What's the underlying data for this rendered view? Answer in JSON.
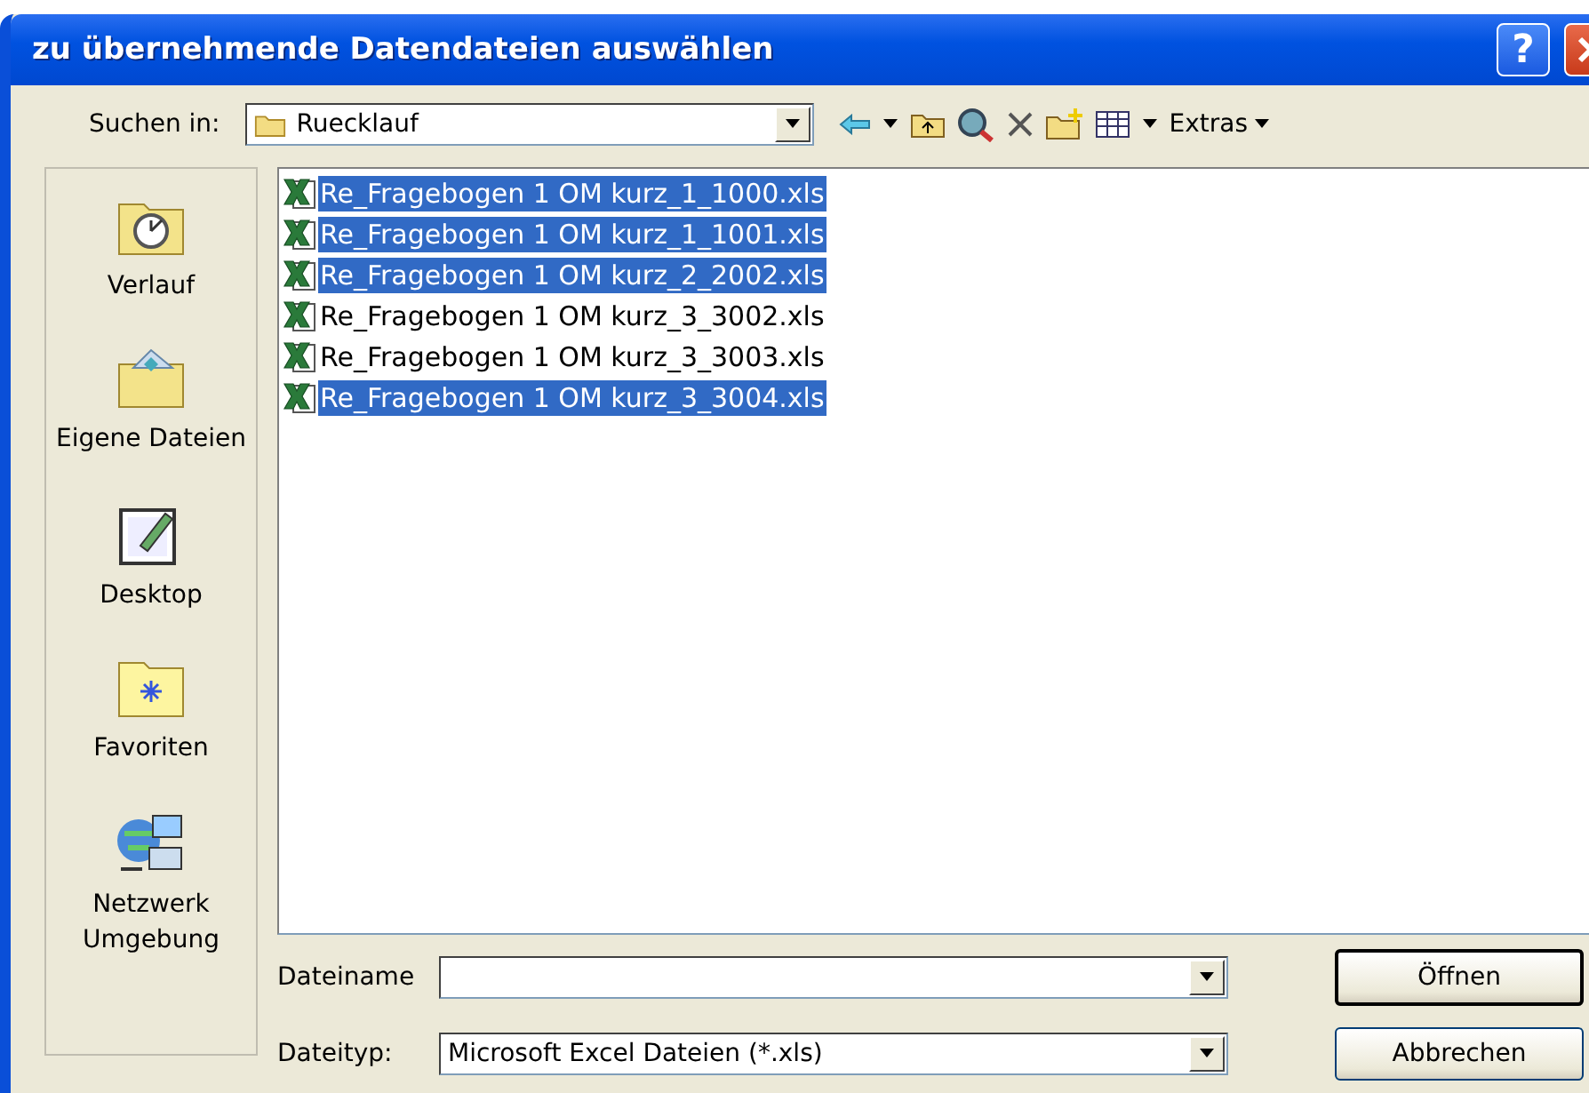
{
  "window": {
    "title": "zu übernehmende Datendateien auswählen",
    "help_button": "?"
  },
  "look_in": {
    "label": "Suchen in:",
    "value": "Ruecklauf"
  },
  "toolbar": {
    "tools_menu": "Extras"
  },
  "places": [
    {
      "label": "Verlauf",
      "kind": "history"
    },
    {
      "label": "Eigene Dateien",
      "kind": "documents"
    },
    {
      "label": "Desktop",
      "kind": "desktop"
    },
    {
      "label": "Favoriten",
      "kind": "favorites"
    },
    {
      "label": "Netzwerk Umgebung",
      "kind": "network"
    }
  ],
  "files": [
    {
      "name": "Re_Fragebogen 1 OM kurz_1_1000.xls",
      "selected": true
    },
    {
      "name": "Re_Fragebogen 1 OM kurz_1_1001.xls",
      "selected": true
    },
    {
      "name": "Re_Fragebogen 1 OM kurz_2_2002.xls",
      "selected": true
    },
    {
      "name": "Re_Fragebogen 1 OM kurz_3_3002.xls",
      "selected": false
    },
    {
      "name": "Re_Fragebogen 1 OM kurz_3_3003.xls",
      "selected": false
    },
    {
      "name": "Re_Fragebogen 1 OM kurz_3_3004.xls",
      "selected": true
    }
  ],
  "file_name": {
    "label": "Dateiname"
  },
  "file_type": {
    "label": "Dateityp:",
    "value": "Microsoft Excel Dateien (*.xls)"
  },
  "buttons": [
    "Öffnen",
    "Abbrechen"
  ]
}
